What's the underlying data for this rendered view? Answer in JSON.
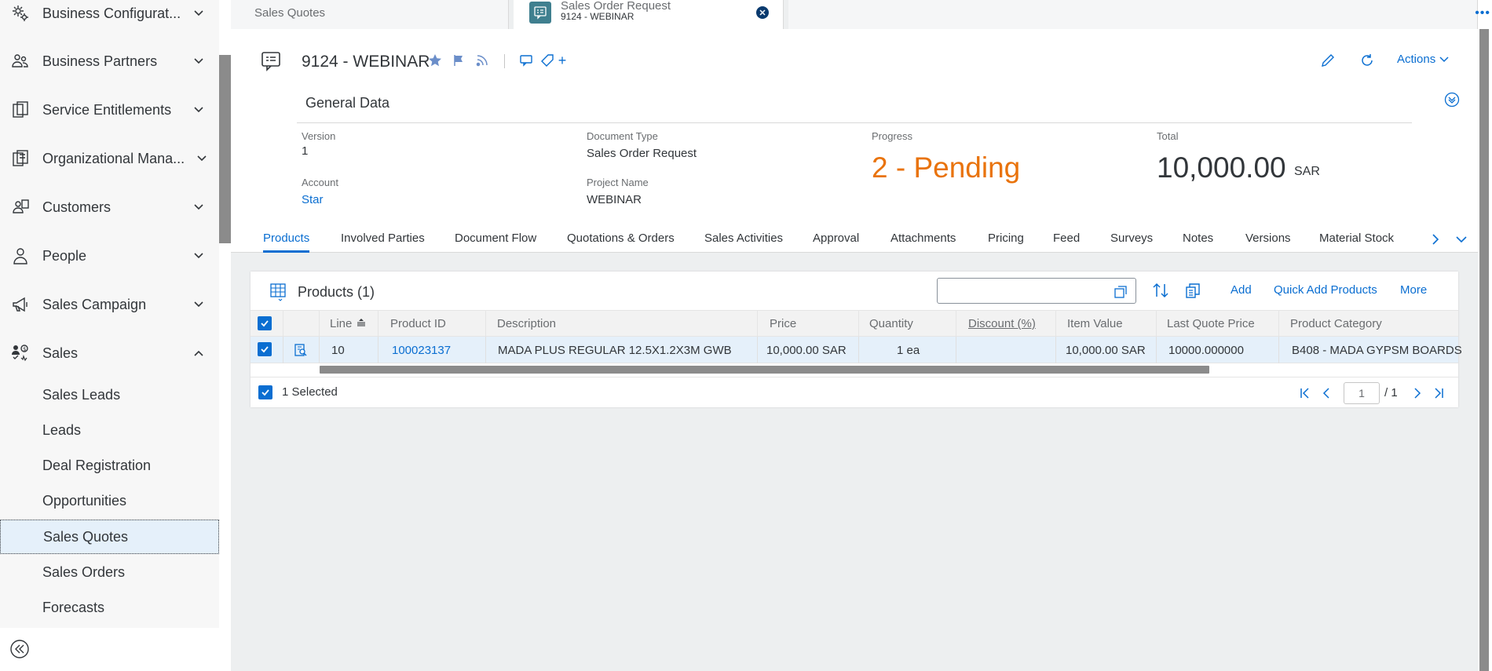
{
  "sidebar": {
    "items": [
      {
        "label": "Business Configurat...",
        "icon": "settings-gear-icon",
        "expanded": false
      },
      {
        "label": "Business Partners",
        "icon": "partners-icon",
        "expanded": false
      },
      {
        "label": "Service Entitlements",
        "icon": "entitlements-icon",
        "expanded": false
      },
      {
        "label": "Organizational Mana...",
        "icon": "org-icon",
        "expanded": false
      },
      {
        "label": "Customers",
        "icon": "customers-icon",
        "expanded": false
      },
      {
        "label": "People",
        "icon": "person-icon",
        "expanded": false
      },
      {
        "label": "Sales Campaign",
        "icon": "megaphone-icon",
        "expanded": false
      },
      {
        "label": "Sales",
        "icon": "sales-icon",
        "expanded": true
      }
    ],
    "sub_items": [
      "Sales Leads",
      "Leads",
      "Deal Registration",
      "Opportunities",
      "Sales Quotes",
      "Sales Orders",
      "Forecasts"
    ],
    "selected_sub_item": "Sales Quotes"
  },
  "tabs": [
    {
      "label": "Sales Quotes"
    },
    {
      "title": "Sales Order Request",
      "subtitle": "9124 - WEBINAR"
    }
  ],
  "header": {
    "title": "9124 - WEBINAR",
    "actions_label": "Actions",
    "section_title": "General Data",
    "fields": {
      "version_label": "Version",
      "version_value": "1",
      "doctype_label": "Document Type",
      "doctype_value": "Sales Order Request",
      "progress_label": "Progress",
      "progress_value": "2 - Pending",
      "total_label": "Total",
      "total_value": "10,000.00",
      "total_currency": "SAR",
      "account_label": "Account",
      "account_value": "Star",
      "project_label": "Project Name",
      "project_value": "WEBINAR"
    }
  },
  "section_tabs": [
    "Products",
    "Involved Parties",
    "Document Flow",
    "Quotations & Orders",
    "Sales Activities",
    "Approval",
    "Attachments",
    "Pricing",
    "Feed",
    "Surveys",
    "Notes",
    "Versions",
    "Material Stock"
  ],
  "active_section_tab": "Products",
  "products": {
    "title": "Products",
    "count": "(1)",
    "search_placeholder": "",
    "buttons": {
      "add": "Add",
      "quick_add": "Quick Add Products",
      "more": "More"
    },
    "columns": [
      "Line",
      "Product ID",
      "Description",
      "Price",
      "Quantity",
      "Discount (%)",
      "Item Value",
      "Last Quote Price",
      "Product Category"
    ],
    "rows": [
      {
        "line": "10",
        "product_id": "100023137",
        "description": "MADA PLUS REGULAR 12.5X1.2X3M GWB",
        "price": "10,000.00 SAR",
        "quantity": "1 ea",
        "discount": "",
        "item_value": "10,000.00 SAR",
        "last_quote_price": "10000.000000",
        "category": "B408 - MADA GYPSM BOARDS"
      }
    ],
    "selected_text": "1 Selected",
    "pager": {
      "page": "1",
      "of": "/ 1"
    }
  },
  "colors": {
    "accent": "#0a6ed1",
    "progress": "#e9730c",
    "selected_row": "#e5f0fa"
  }
}
